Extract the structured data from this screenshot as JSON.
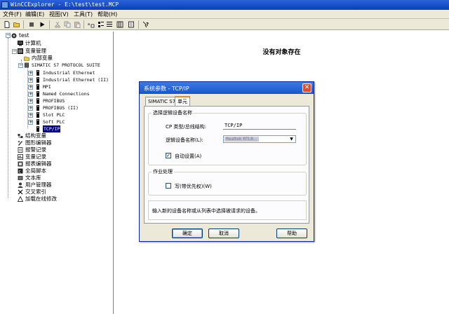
{
  "window": {
    "title": "WinCCExplorer - E:\\test\\test.MCP"
  },
  "menu": [
    "文件(F)",
    "编辑(E)",
    "视图(V)",
    "工具(T)",
    "帮助(H)"
  ],
  "toolbar": {
    "buttons": [
      "new-icon",
      "open-icon",
      "stop-icon",
      "run-icon",
      "cut-icon",
      "copy-icon",
      "paste-icon",
      "large-icons-icon",
      "small-icons-icon",
      "list-icon",
      "details-icon",
      "properties-icon",
      "help-icon"
    ]
  },
  "tree": {
    "root": "test",
    "computer": "计算机",
    "tag_management": "变量管理",
    "internal_tags": "内部变量",
    "protocol": "SIMATIC S7 PROTOCOL SUITE",
    "units": [
      "Industrial Ethernet",
      "Industrial Ethernet (II)",
      "MPI",
      "Named Connections",
      "PROFIBUS",
      "PROFIBUS (II)",
      "Slot PLC",
      "Soft PLC",
      "TCP/IP"
    ],
    "others": [
      "结构变量",
      "图形编辑器",
      "报警记录",
      "变量记录",
      "报表编辑器",
      "全局脚本",
      "文本库",
      "用户管理器",
      "交叉索引",
      "加载在线修改"
    ]
  },
  "main": {
    "empty_message": "没有对象存在"
  },
  "dialog": {
    "title": "系统参数 - TCP/IP",
    "tabs": [
      "SIMATIC S7",
      "单元"
    ],
    "group_logical": "选择逻辑设备名称",
    "cp_type_label": "CP 类型/总线结构:",
    "cp_type_value": "TCP/IP",
    "logical_name_label": "逻辑设备名称(L):",
    "logical_name_value": "Realtek RTL8...",
    "auto_setting_label": "自动设置(A)",
    "auto_setting_checked": true,
    "group_job": "作业处理",
    "write_priority_label": "写(带优先权)(W)",
    "write_priority_checked": false,
    "info_text": "输入新的设备名称或从列表中选择被请求的设备。",
    "ok_label": "确定",
    "cancel_label": "取消",
    "help_label": "帮助"
  },
  "colors": {
    "titlebar": "#0a3fb8",
    "dialog_face": "#ece9d8",
    "selection": "#000080",
    "close_button": "#d8502f"
  }
}
